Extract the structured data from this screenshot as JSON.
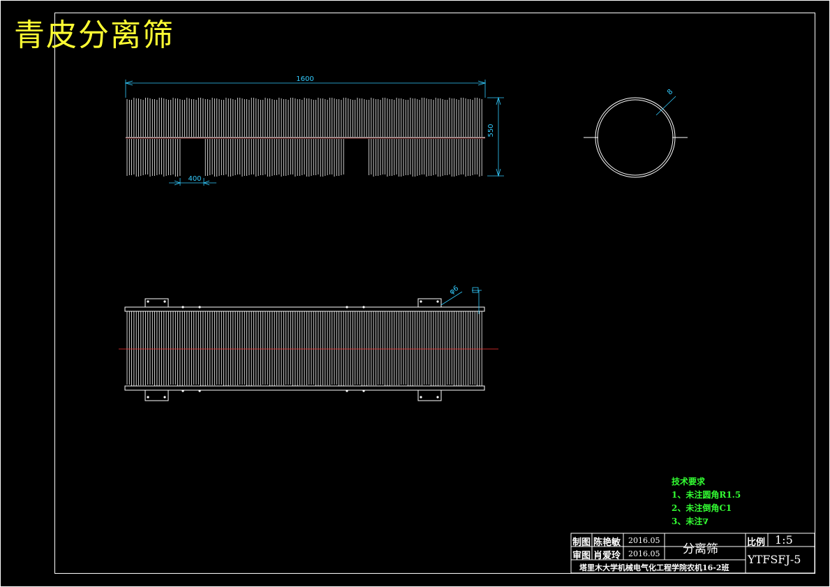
{
  "title": "青皮分离筛",
  "dimensions": {
    "length": "1600",
    "height": "550",
    "gap": "400",
    "ring": "8",
    "hole": "6"
  },
  "tech_requirements": {
    "heading": "技术要求",
    "items": [
      "1、未注圆角R1.5",
      "2、未注倒角C1",
      "3、未注"
    ]
  },
  "title_block": {
    "drawn_label": "制图",
    "drawn_by": "陈艳敏",
    "drawn_date": "2016.05",
    "checked_label": "审图",
    "checked_by": "肖爱玲",
    "checked_date": "2016.05",
    "part_name": "分离筛",
    "scale_label": "比例",
    "scale": "1:5",
    "drawing_no": "YTFSFJ-5",
    "school": "塔里木大学机械电气化工程学院农机16-2班"
  },
  "colors": {
    "background": "#000000",
    "lines": "#ffffff",
    "dimension": "#33ccff",
    "title": "#ffff33",
    "notes": "#33ff33",
    "centerline": "#ff3333"
  }
}
